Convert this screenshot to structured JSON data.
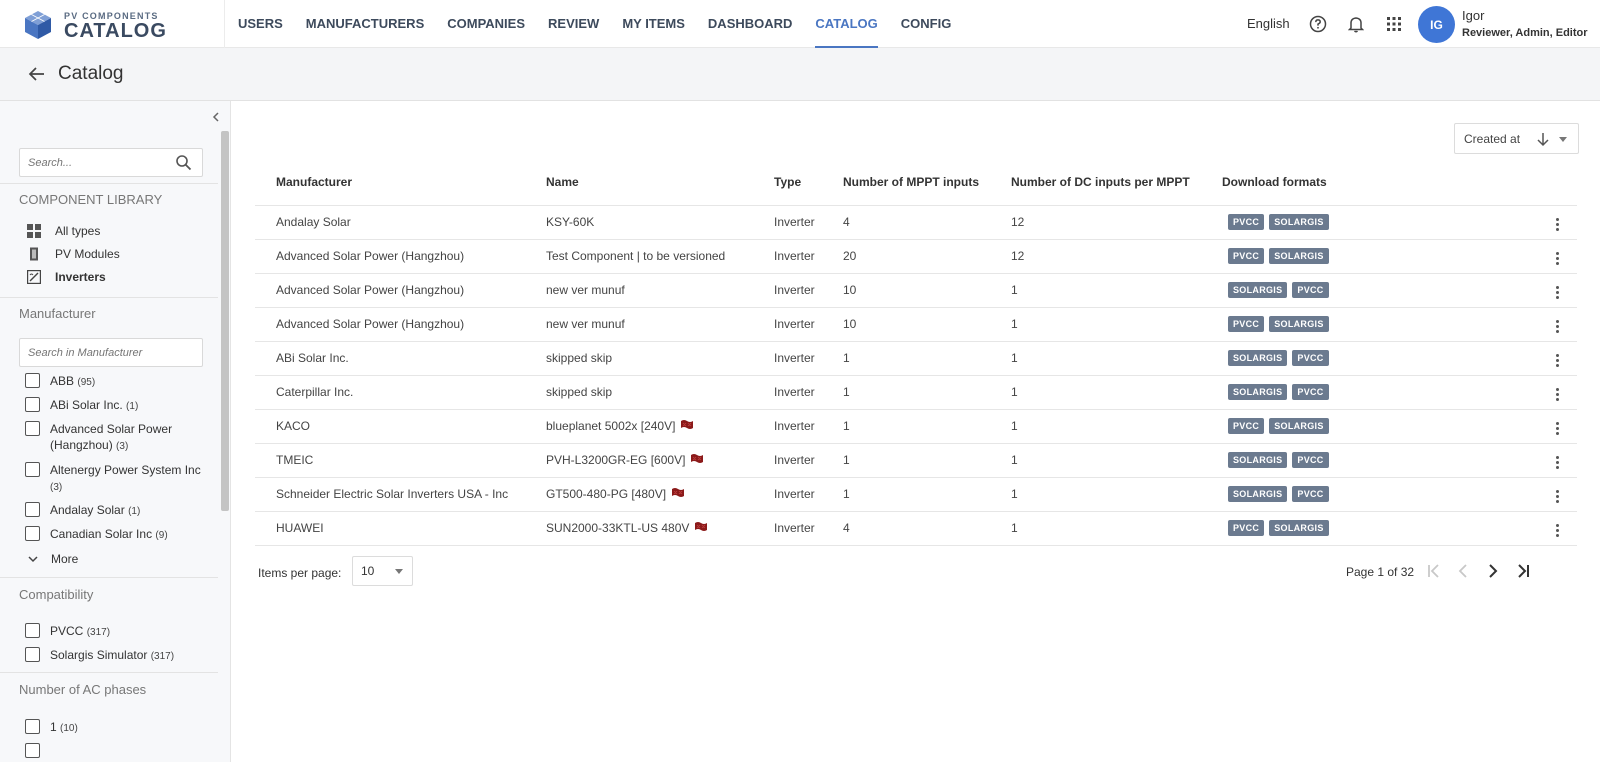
{
  "brand": {
    "small": "PV COMPONENTS",
    "big": "CATALOG"
  },
  "nav": [
    {
      "label": "USERS",
      "active": false
    },
    {
      "label": "MANUFACTURERS",
      "active": false
    },
    {
      "label": "COMPANIES",
      "active": false
    },
    {
      "label": "REVIEW",
      "active": false
    },
    {
      "label": "MY ITEMS",
      "active": false
    },
    {
      "label": "DASHBOARD",
      "active": false
    },
    {
      "label": "CATALOG",
      "active": true
    },
    {
      "label": "CONFIG",
      "active": false
    }
  ],
  "header": {
    "language": "English",
    "avatar_initials": "IG",
    "user_name": "Igor",
    "user_roles": "Reviewer, Admin, Editor"
  },
  "page": {
    "title": "Catalog"
  },
  "sidebar": {
    "search_placeholder": "Search...",
    "library_title": "COMPONENT LIBRARY",
    "library_items": [
      {
        "label": "All types",
        "icon": "grid-icon"
      },
      {
        "label": "PV Modules",
        "icon": "pv-module-icon"
      },
      {
        "label": "Inverters",
        "icon": "inverter-icon"
      }
    ],
    "manufacturer_title": "Manufacturer",
    "manufacturer_search_placeholder": "Search in Manufacturer",
    "manufacturers": [
      {
        "name": "ABB",
        "count": "(95)"
      },
      {
        "name": "ABi Solar Inc.",
        "count": "(1)"
      },
      {
        "name": "Advanced Solar Power (Hangzhou)",
        "count": "(3)"
      },
      {
        "name": "Altenergy Power System Inc",
        "count": "(3)"
      },
      {
        "name": "Andalay Solar",
        "count": "(1)"
      },
      {
        "name": "Canadian Solar Inc",
        "count": "(9)"
      }
    ],
    "more_label": "More",
    "compat_title": "Compatibility",
    "compat": [
      {
        "name": "PVCC",
        "count": "(317)"
      },
      {
        "name": "Solargis Simulator",
        "count": "(317)"
      }
    ],
    "ac_title": "Number of AC phases",
    "ac": [
      {
        "name": "1",
        "count": "(10)"
      }
    ]
  },
  "sort": {
    "label": "Created at"
  },
  "table": {
    "headers": [
      "Manufacturer",
      "Name",
      "Type",
      "Number of MPPT inputs",
      "Number of DC inputs per MPPT",
      "Download formats"
    ],
    "rows": [
      {
        "manufacturer": "Andalay Solar",
        "name": "KSY-60K",
        "warn": false,
        "type": "Inverter",
        "mppt": "4",
        "dc": "12",
        "formats": [
          "PVCC",
          "SOLARGIS"
        ]
      },
      {
        "manufacturer": "Advanced Solar Power (Hangzhou)",
        "name": "Test Component | to be versioned",
        "warn": false,
        "type": "Inverter",
        "mppt": "20",
        "dc": "12",
        "formats": [
          "PVCC",
          "SOLARGIS"
        ]
      },
      {
        "manufacturer": "Advanced Solar Power (Hangzhou)",
        "name": "new ver munuf",
        "warn": false,
        "type": "Inverter",
        "mppt": "10",
        "dc": "1",
        "formats": [
          "SOLARGIS",
          "PVCC"
        ]
      },
      {
        "manufacturer": "Advanced Solar Power (Hangzhou)",
        "name": "new ver munuf",
        "warn": false,
        "type": "Inverter",
        "mppt": "10",
        "dc": "1",
        "formats": [
          "PVCC",
          "SOLARGIS"
        ]
      },
      {
        "manufacturer": "ABi Solar Inc.",
        "name": "skipped skip",
        "warn": false,
        "type": "Inverter",
        "mppt": "1",
        "dc": "1",
        "formats": [
          "SOLARGIS",
          "PVCC"
        ]
      },
      {
        "manufacturer": "Caterpillar Inc.",
        "name": "skipped skip",
        "warn": false,
        "type": "Inverter",
        "mppt": "1",
        "dc": "1",
        "formats": [
          "SOLARGIS",
          "PVCC"
        ]
      },
      {
        "manufacturer": "KACO",
        "name": "blueplanet 5002x [240V]",
        "warn": true,
        "type": "Inverter",
        "mppt": "1",
        "dc": "1",
        "formats": [
          "PVCC",
          "SOLARGIS"
        ]
      },
      {
        "manufacturer": "TMEIC",
        "name": "PVH-L3200GR-EG [600V]",
        "warn": true,
        "type": "Inverter",
        "mppt": "1",
        "dc": "1",
        "formats": [
          "SOLARGIS",
          "PVCC"
        ]
      },
      {
        "manufacturer": "Schneider Electric Solar Inverters USA - Inc",
        "name": "GT500-480-PG [480V]",
        "warn": true,
        "type": "Inverter",
        "mppt": "1",
        "dc": "1",
        "formats": [
          "SOLARGIS",
          "PVCC"
        ]
      },
      {
        "manufacturer": "HUAWEI",
        "name": "SUN2000-33KTL-US 480V",
        "warn": true,
        "type": "Inverter",
        "mppt": "4",
        "dc": "1",
        "formats": [
          "PVCC",
          "SOLARGIS"
        ]
      }
    ]
  },
  "pagination": {
    "items_per_page_label": "Items per page:",
    "items_per_page": "10",
    "page_info": "Page 1 of 32"
  },
  "colors": {
    "accent": "#4a76c2",
    "badge": "#6b7a8f",
    "avatar": "#3f76d6",
    "warn": "#8b1a1a"
  }
}
